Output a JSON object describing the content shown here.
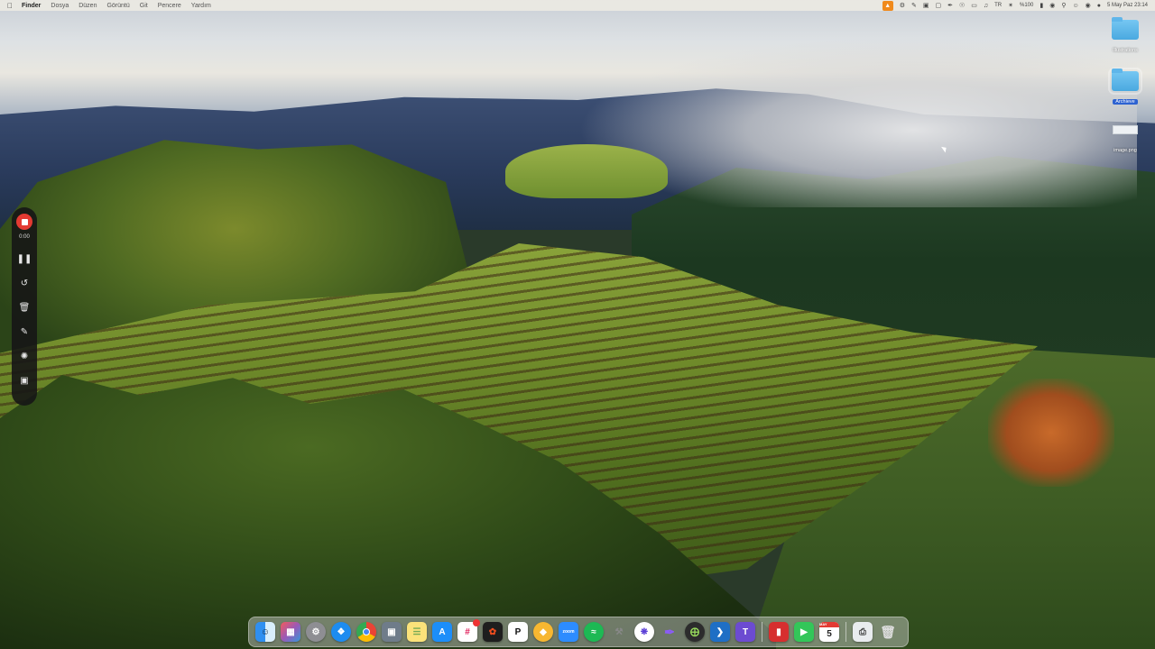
{
  "menubar": {
    "apple_icon": "apple-icon",
    "app_name": "Finder",
    "menus": [
      "Dosya",
      "Düzen",
      "Görüntü",
      "Git",
      "Pencere",
      "Yardım"
    ],
    "battery_percent": "%100",
    "clock": "5 May Paz  23:14",
    "input_source": "TR"
  },
  "desktop": {
    "icons": [
      {
        "label": "Illustrations",
        "type": "folder",
        "selected": false
      },
      {
        "label": "Archieve",
        "type": "folder",
        "selected": true
      },
      {
        "label": "image.png",
        "type": "file",
        "selected": false
      }
    ]
  },
  "recorder": {
    "elapsed": "0:00",
    "accent_color": "#e33a32"
  },
  "dock": {
    "calendar_day": "5",
    "calendar_month": "MAY",
    "apps": [
      "finder",
      "launchpad",
      "system-settings",
      "safari",
      "chrome",
      "preview",
      "notes",
      "app-store",
      "slack",
      "figma",
      "pricetag",
      "sketch",
      "zoom",
      "spotify",
      "automator",
      "chatgpt",
      "affinity",
      "compass",
      "vscode",
      "teams",
      "parallels",
      "facetime",
      "calendar",
      "printer",
      "trash"
    ]
  },
  "colors": {
    "menubar_bg": "#ece9e3",
    "selection": "#2d62d1",
    "folder": "#5fb6ea"
  }
}
